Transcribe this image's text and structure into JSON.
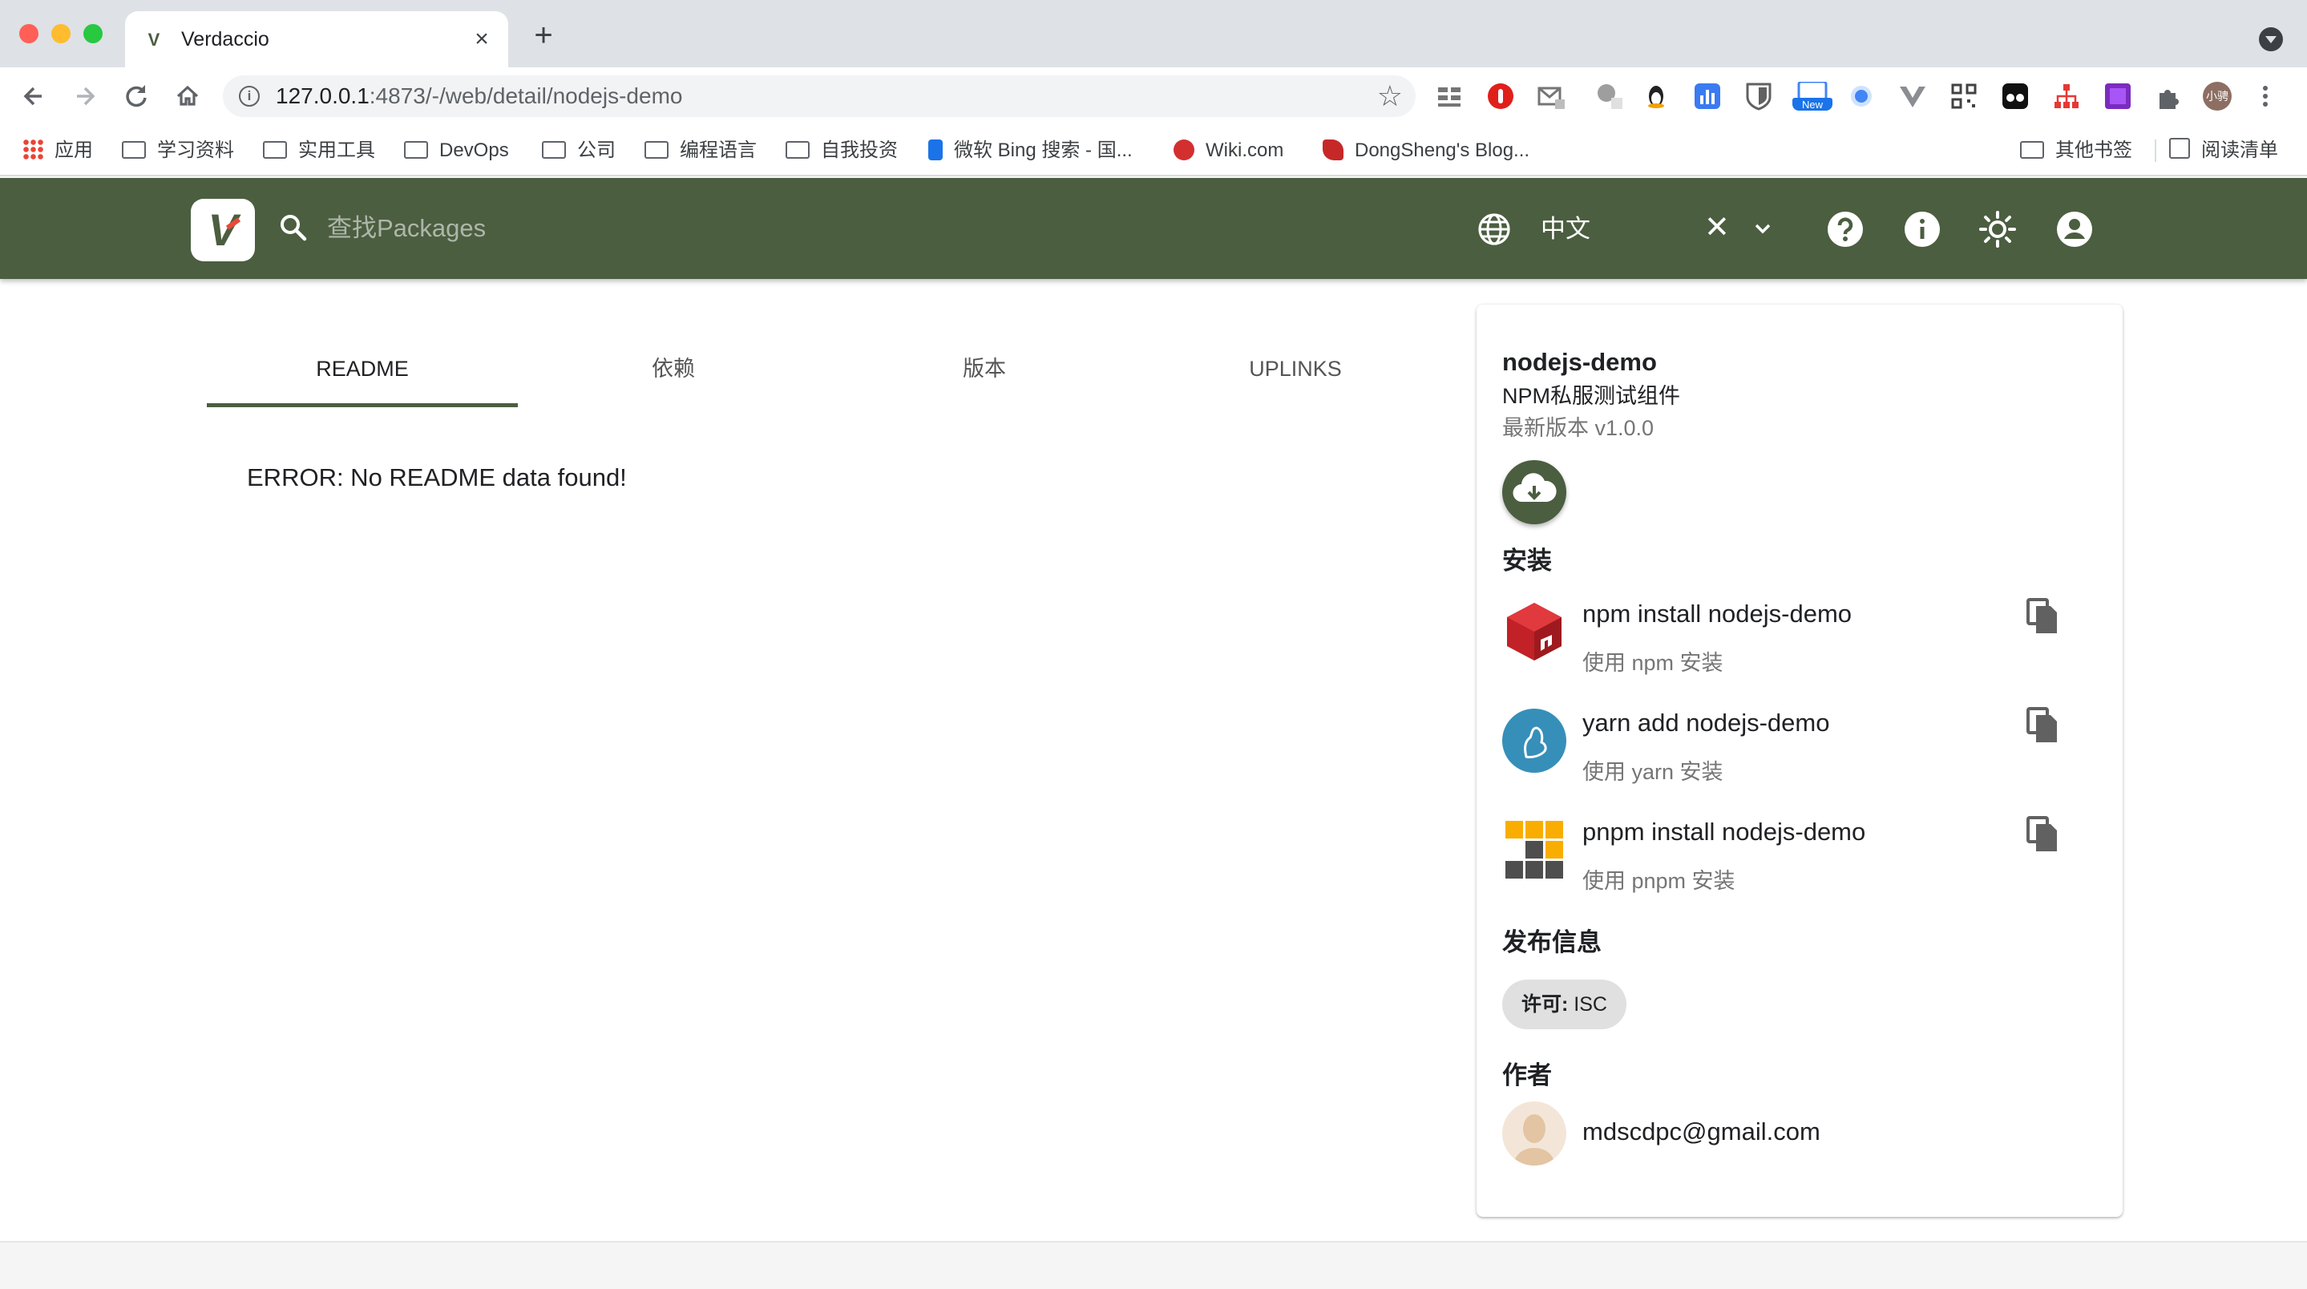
{
  "browser": {
    "tab_title": "Verdaccio",
    "tab_favicon": "V",
    "url_host": "127.0.0.1",
    "url_rest": ":4873/-/web/detail/nodejs-demo",
    "new_badge": "New",
    "profile_label": "小骋",
    "bookmarks": [
      {
        "label": "应用",
        "icon": "apps-grid-icon"
      },
      {
        "label": "学习资料",
        "icon": "folder-icon"
      },
      {
        "label": "实用工具",
        "icon": "folder-icon"
      },
      {
        "label": "DevOps",
        "icon": "folder-icon"
      },
      {
        "label": "公司",
        "icon": "folder-icon"
      },
      {
        "label": "编程语言",
        "icon": "folder-icon"
      },
      {
        "label": "自我投资",
        "icon": "folder-icon"
      },
      {
        "label": "微软 Bing 搜索 - 国...",
        "icon": "bing-icon"
      },
      {
        "label": "Wiki.com",
        "icon": "wiki-icon"
      },
      {
        "label": "DongSheng's Blog...",
        "icon": "blog-icon"
      }
    ],
    "bookmarks_right": [
      {
        "label": "其他书签",
        "icon": "folder-icon"
      },
      {
        "label": "阅读清单",
        "icon": "reading-list-icon"
      }
    ]
  },
  "header": {
    "search_placeholder": "查找Packages",
    "language": "中文",
    "clear_symbol": "✕",
    "brand_color": "#4b5e40"
  },
  "tabs": [
    "README",
    "依赖",
    "版本",
    "UPLINKS"
  ],
  "readme": {
    "message": "ERROR: No README data found!"
  },
  "package": {
    "name": "nodejs-demo",
    "description": "NPM私服测试组件",
    "version_label": "最新版本 v1.0.0",
    "install_title": "安装",
    "install": [
      {
        "command": "npm install nodejs-demo",
        "hint": "使用 npm 安装",
        "icon": "npm-icon"
      },
      {
        "command": "yarn add nodejs-demo",
        "hint": "使用 yarn 安装",
        "icon": "yarn-icon"
      },
      {
        "command": "pnpm install nodejs-demo",
        "hint": "使用 pnpm 安装",
        "icon": "pnpm-icon"
      }
    ],
    "publish_title": "发布信息",
    "license_label": "许可:",
    "license_value": "ISC",
    "author_title": "作者",
    "author_email": "mdscdpc@gmail.com"
  }
}
